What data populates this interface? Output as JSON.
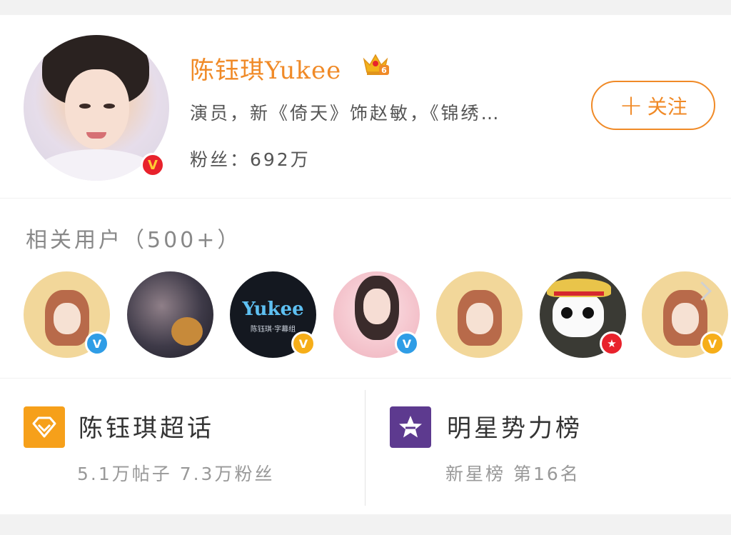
{
  "profile": {
    "name": "陈钰琪Yukee",
    "crown_level": "6",
    "verified_badge": "V",
    "description": "演员，新《倚天》饰赵敏，《锦绣…",
    "fans": "粉丝：692万",
    "follow_button": {
      "icon": "plus-icon",
      "label": "关注"
    },
    "accent_color": "#f08a27"
  },
  "related": {
    "title": "相关用户（500+）",
    "users": [
      {
        "avatar": "cartoon-girl-avatar",
        "badge": "V",
        "badge_color": "#2f9de6"
      },
      {
        "avatar": "photo-avatar",
        "badge": "",
        "badge_color": ""
      },
      {
        "avatar": "yukee-logo-avatar",
        "logo_text": "Yukee",
        "logo_sub": "陈钰琪·字幕组",
        "badge": "V",
        "badge_color": "#f6ae19"
      },
      {
        "avatar": "photo-avatar",
        "badge": "V",
        "badge_color": "#2f9de6"
      },
      {
        "avatar": "cartoon-girl-avatar",
        "badge": "",
        "badge_color": ""
      },
      {
        "avatar": "pirate-skull-avatar",
        "badge": "★",
        "badge_color": "#e8222c"
      },
      {
        "avatar": "cartoon-girl-avatar",
        "badge": "V",
        "badge_color": "#f6ae19"
      }
    ]
  },
  "tiles": {
    "supertopic": {
      "icon": "diamond-icon",
      "icon_color": "#f6a01a",
      "title": "陈钰琪超话",
      "stats": "5.1万帖子  7.3万粉丝"
    },
    "star_rank": {
      "icon": "star-icon",
      "icon_color": "#5d3a8f",
      "title": "明星势力榜",
      "rank": "新星榜 第16名"
    }
  }
}
